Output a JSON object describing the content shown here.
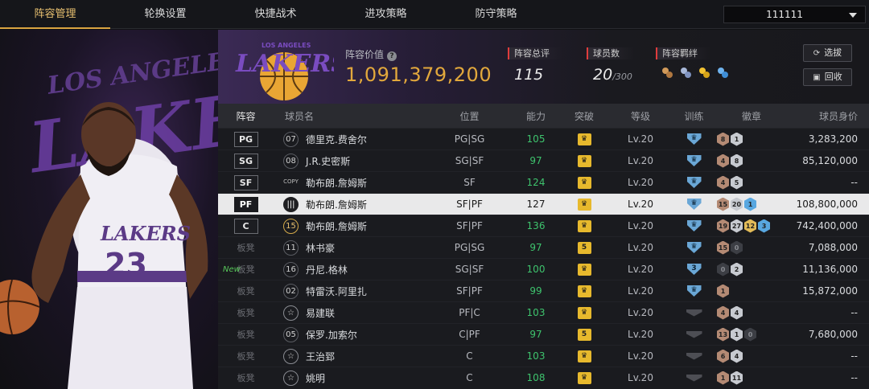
{
  "tabs": [
    "阵容管理",
    "轮换设置",
    "快捷战术",
    "进攻策略",
    "防守策略"
  ],
  "active_tab": 0,
  "account_selector": {
    "value": "111111"
  },
  "header": {
    "logo_text": "LAKERS",
    "logo_subtext": "LOS ANGELES",
    "value_label": "阵容价值",
    "value": "1,091,379,200",
    "overall_label": "阵容总评",
    "overall": "115",
    "players_label": "球员数",
    "players": "20",
    "players_max": "/300",
    "bonds_label": "阵容羁绊",
    "bond_icons": [
      "bond-icon-1",
      "bond-icon-2",
      "bond-icon-3",
      "bond-icon-4"
    ],
    "select_btn": "选拔",
    "recycle_btn": "回收"
  },
  "columns": [
    "阵容",
    "球员名",
    "位置",
    "能力",
    "突破",
    "等级",
    "训练",
    "徽章",
    "球员身价"
  ],
  "rows": [
    {
      "slot": "PG",
      "bench": false,
      "num": "07",
      "numStyle": "",
      "name": "德里克.费舍尔",
      "pos": "PG|SG",
      "ability": "105",
      "breakthrough": "crown",
      "level": "Lv.20",
      "training": "shield",
      "badges": [
        [
          "bronze",
          "8"
        ],
        [
          "silver",
          "1"
        ]
      ],
      "value": "3,283,200"
    },
    {
      "slot": "SG",
      "bench": false,
      "num": "08",
      "numStyle": "",
      "name": "J.R.史密斯",
      "pos": "SG|SF",
      "ability": "97",
      "breakthrough": "crown",
      "level": "Lv.20",
      "training": "shield",
      "badges": [
        [
          "bronze",
          "4"
        ],
        [
          "silver",
          "8"
        ]
      ],
      "value": "85,120,000"
    },
    {
      "slot": "SF",
      "bench": false,
      "num": "COPY",
      "numStyle": "copy",
      "name": "勒布朗.詹姆斯",
      "pos": "SF",
      "ability": "124",
      "breakthrough": "crown",
      "level": "Lv.20",
      "training": "shield",
      "badges": [
        [
          "bronze",
          "4"
        ],
        [
          "silver",
          "5"
        ]
      ],
      "value": "--"
    },
    {
      "slot": "PF",
      "bench": false,
      "selected": true,
      "num": "|||",
      "numStyle": "",
      "name": "勒布朗.詹姆斯",
      "pos": "SF|PF",
      "ability": "127",
      "breakthrough": "crown",
      "level": "Lv.20",
      "training": "shield",
      "badges": [
        [
          "bronze",
          "15"
        ],
        [
          "silver",
          "20"
        ],
        [
          "blue",
          "1"
        ]
      ],
      "value": "108,800,000"
    },
    {
      "slot": "C",
      "bench": false,
      "num": "15",
      "numStyle": "gold",
      "name": "勒布朗.詹姆斯",
      "pos": "SF|PF",
      "ability": "136",
      "breakthrough": "crown",
      "level": "Lv.20",
      "training": "shield",
      "badges": [
        [
          "bronze",
          "19"
        ],
        [
          "silver",
          "27"
        ],
        [
          "gold",
          "12"
        ],
        [
          "blue",
          "3"
        ]
      ],
      "value": "742,400,000"
    },
    {
      "slot": "板凳",
      "bench": true,
      "num": "11",
      "numStyle": "",
      "name": "林书豪",
      "pos": "PG|SG",
      "ability": "97",
      "breakthrough": "5",
      "level": "Lv.20",
      "training": "shield",
      "badges": [
        [
          "bronze",
          "15"
        ],
        [
          "dim",
          "0"
        ]
      ],
      "value": "7,088,000"
    },
    {
      "slot": "板凳",
      "bench": true,
      "isNew": true,
      "num": "16",
      "numStyle": "",
      "name": "丹尼.格林",
      "pos": "SG|SF",
      "ability": "100",
      "breakthrough": "crown",
      "level": "Lv.20",
      "training": "shield3",
      "badges": [
        [
          "dim",
          "0"
        ],
        [
          "silver",
          "2"
        ]
      ],
      "value": "11,136,000"
    },
    {
      "slot": "板凳",
      "bench": true,
      "num": "02",
      "numStyle": "",
      "name": "特雷沃.阿里扎",
      "pos": "SF|PF",
      "ability": "99",
      "breakthrough": "crown",
      "level": "Lv.20",
      "training": "shield",
      "badges": [
        [
          "bronze",
          "1"
        ]
      ],
      "value": "15,872,000"
    },
    {
      "slot": "板凳",
      "bench": true,
      "num": "☆",
      "numStyle": "star",
      "name": "易建联",
      "pos": "PF|C",
      "ability": "103",
      "breakthrough": "crown",
      "level": "Lv.20",
      "training": "dark",
      "badges": [
        [
          "bronze",
          "4"
        ],
        [
          "silver",
          "4"
        ]
      ],
      "value": "--"
    },
    {
      "slot": "板凳",
      "bench": true,
      "num": "05",
      "numStyle": "",
      "name": "保罗.加索尔",
      "pos": "C|PF",
      "ability": "97",
      "breakthrough": "5",
      "level": "Lv.20",
      "training": "dark",
      "badges": [
        [
          "bronze",
          "13"
        ],
        [
          "silver",
          "1"
        ],
        [
          "dim",
          "0"
        ]
      ],
      "value": "7,680,000"
    },
    {
      "slot": "板凳",
      "bench": true,
      "num": "☆",
      "numStyle": "star",
      "name": "王治郅",
      "pos": "C",
      "ability": "103",
      "breakthrough": "crown",
      "level": "Lv.20",
      "training": "dark",
      "badges": [
        [
          "bronze",
          "6"
        ],
        [
          "silver",
          "4"
        ]
      ],
      "value": "--"
    },
    {
      "slot": "板凳",
      "bench": true,
      "num": "☆",
      "numStyle": "star",
      "name": "姚明",
      "pos": "C",
      "ability": "108",
      "breakthrough": "crown",
      "level": "Lv.20",
      "training": "dark",
      "badges": [
        [
          "bronze",
          "1"
        ],
        [
          "silver",
          "11"
        ]
      ],
      "value": "--"
    }
  ],
  "player_art": {
    "team": "LAKERS",
    "jersey_number": "23"
  },
  "new_label": "New",
  "colors": {
    "accent": "#e2a83c",
    "ability_green": "#3ec36d",
    "tab_active": "#e8c070"
  }
}
